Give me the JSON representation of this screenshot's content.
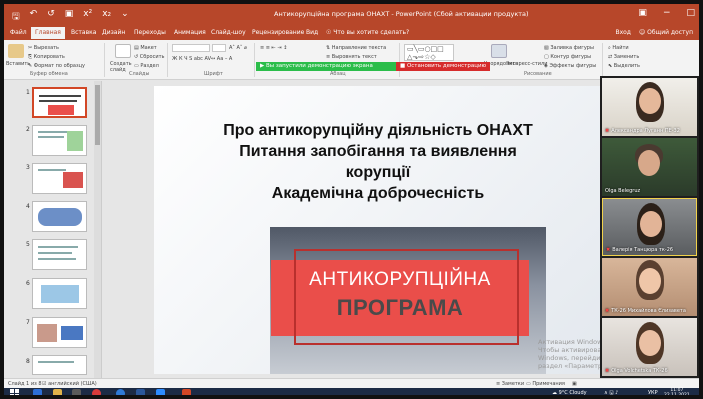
{
  "window": {
    "title": "Антикорупційна програма ОНАХТ - PowerPoint (Сбой активации продукта)"
  },
  "tabs": [
    "Файл",
    "Главная",
    "Вставка",
    "Дизайн",
    "Переходы",
    "Анимация",
    "Слайд-шоу",
    "Рецензирование",
    "Вид",
    "Что вы хотите сделать?"
  ],
  "tabs_right": [
    "Вход",
    "Общий доступ"
  ],
  "ribbon": {
    "paste": "Вставить",
    "cut": "Вырезать",
    "copy": "Копировать",
    "format_painter": "Формат по образцу",
    "clipboard_group": "Буфер обмена",
    "new_slide": "Создать слайд",
    "layout": "Макет",
    "reset": "Сбросить",
    "section": "Раздел",
    "slides_group": "Слайды",
    "font_group": "Шрифт",
    "paragraph_group": "Абзац",
    "text_direction": "Направление текста",
    "align_text": "Выровнять текст",
    "arrange": "Упорядочить",
    "quick_styles": "Экспресс-стили",
    "shape_fill": "Заливка фигуры",
    "shape_outline": "Контур фигуры",
    "shape_effects": "Эффекты фигуры",
    "drawing_group": "Рисование",
    "find": "Найти",
    "replace": "Заменить",
    "select": "Выделить"
  },
  "screen_share": {
    "sharing_notice": "Вы запустили демонстрацию экрана",
    "stop_button": "Остановить демонстрацию"
  },
  "thumbnails": [
    "1",
    "2",
    "3",
    "4",
    "5",
    "6",
    "7",
    "8"
  ],
  "slide": {
    "line1": "Про антикорупційну діяльність ОНАХТ",
    "line2": "Питання запобігання та виявлення",
    "line3": "корупції",
    "line4": "Академічна доброчесність",
    "image_line1": "АНТИКОРУПЦІЙНА",
    "image_line2": "ПРОГРАМА",
    "watermark_1": "Активация Windows",
    "watermark_2": "Чтобы активировать Windows, перейдите в раздел «Параметры»."
  },
  "participants": [
    {
      "name": "Александра Луганн ПЕ-32"
    },
    {
      "name": "Olga Belegruz"
    },
    {
      "name": "Валерія Танцюра тк-26"
    },
    {
      "name": "ТК-26 Михайлова Єлизавета"
    },
    {
      "name": "Olga Volchetska ТК-26"
    }
  ],
  "status": {
    "slide_counter": "Слайд 1 из 8",
    "language": "английский (США)",
    "notes": "Заметки",
    "comments": "Примечания"
  },
  "taskbar": {
    "weather": "9°C Cloudy",
    "lang": "УКР",
    "time": "11:07",
    "date": "22.11.2021"
  },
  "colors": {
    "accent": "#b7472a",
    "share_green": "#2bbd4a",
    "share_red": "#d62c2c",
    "slide_red": "#ea4e4a"
  }
}
